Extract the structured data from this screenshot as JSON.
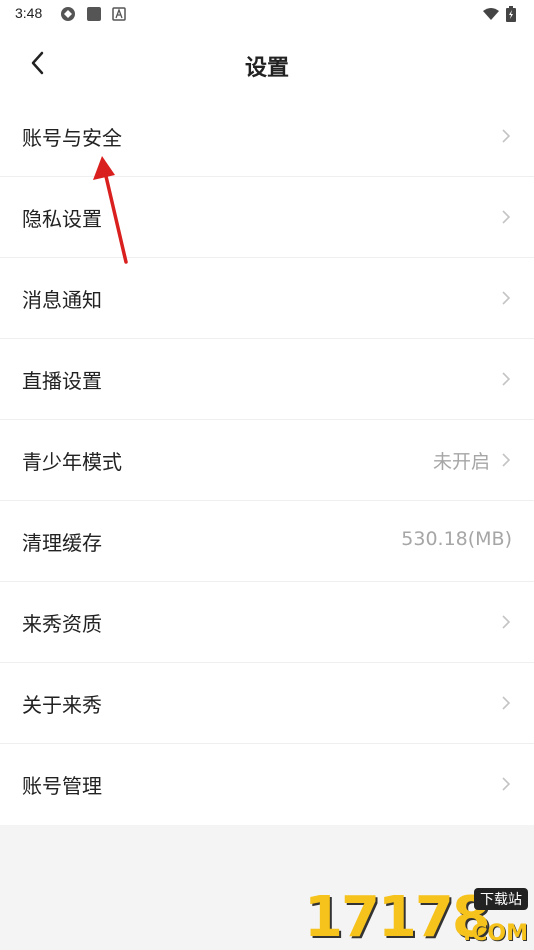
{
  "status_bar": {
    "time": "3:48",
    "left_icons": [
      "sync-icon",
      "square-icon",
      "a-icon"
    ],
    "right_icons": [
      "wifi-icon",
      "battery-icon"
    ]
  },
  "header": {
    "title": "设置",
    "back_icon": "chevron-left-icon"
  },
  "settings": [
    {
      "label": "账号与安全",
      "value": "",
      "chevron": true
    },
    {
      "label": "隐私设置",
      "value": "",
      "chevron": true
    },
    {
      "label": "消息通知",
      "value": "",
      "chevron": true
    },
    {
      "label": "直播设置",
      "value": "",
      "chevron": true
    },
    {
      "label": "青少年模式",
      "value": "未开启",
      "chevron": true
    },
    {
      "label": "清理缓存",
      "value": "530.18(MB)",
      "chevron": false
    },
    {
      "label": "来秀资质",
      "value": "",
      "chevron": true
    },
    {
      "label": "关于来秀",
      "value": "",
      "chevron": true
    },
    {
      "label": "账号管理",
      "value": "",
      "chevron": true
    }
  ],
  "watermark": {
    "number": "17178",
    "badge": "下载站",
    "suffix": ".COM"
  },
  "colors": {
    "background": "#f4f4f4",
    "annotation_arrow": "#d9201f",
    "watermark": "#f6c21c"
  }
}
